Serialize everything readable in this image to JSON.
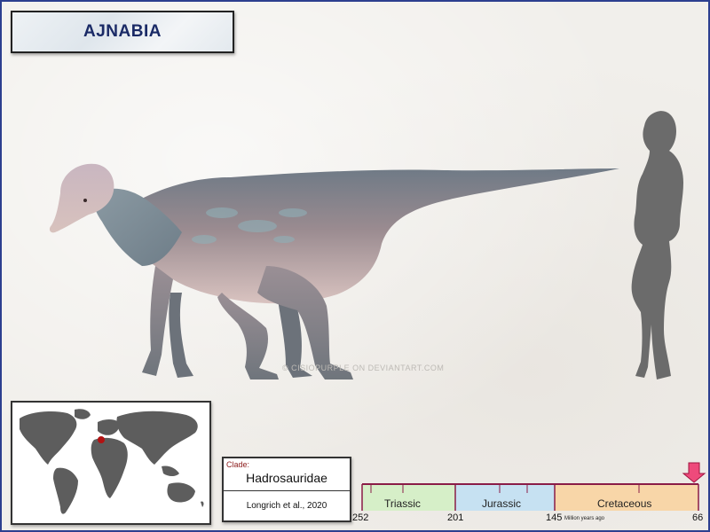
{
  "title": "AJNABIA",
  "watermark": "© CISIOPURPLE ON DEVIANTART.COM",
  "clade": {
    "label": "Clade:",
    "name": "Hadrosauridae",
    "reference": "Longrich et al., 2020"
  },
  "timeline": {
    "periods": [
      {
        "name": "Triassic",
        "color": "#d6efc8"
      },
      {
        "name": "Jurassic",
        "color": "#c6e1f2"
      },
      {
        "name": "Cretaceous",
        "color": "#f8d6a8"
      }
    ],
    "ages": [
      "252",
      "201",
      "145",
      "66"
    ],
    "unit": "Million years ago",
    "marker_color": "#ee4a7b"
  },
  "colors": {
    "frame": "#2c3f8f",
    "title_text": "#1a2a66",
    "map_land": "#5d5d5d",
    "location_dot": "#b31212",
    "silhouette": "#6b6b6b"
  },
  "icons": [
    "location-dot-icon",
    "arrow-down-icon"
  ]
}
